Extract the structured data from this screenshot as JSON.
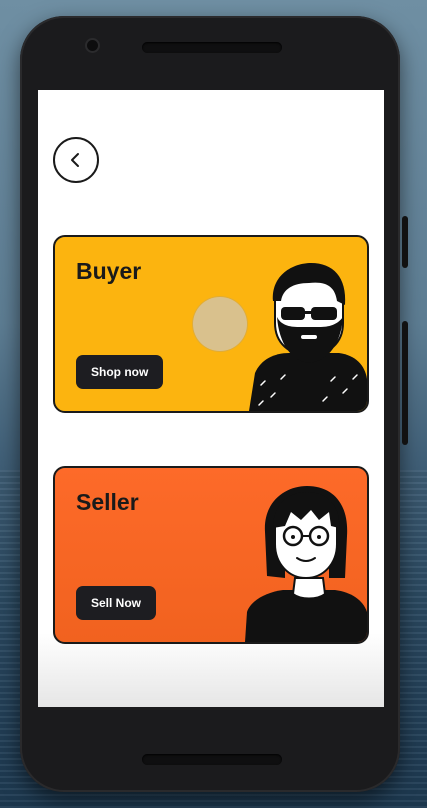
{
  "cards": {
    "buyer": {
      "title": "Buyer",
      "button_label": "Shop now"
    },
    "seller": {
      "title": "Seller",
      "button_label": "Sell Now"
    }
  },
  "icons": {
    "back": "chevron-left-icon"
  },
  "colors": {
    "buyer_card": "#fcb40f",
    "seller_card": "#fd6a29",
    "button": "#1d1d21",
    "outline": "#1a1a1a"
  }
}
